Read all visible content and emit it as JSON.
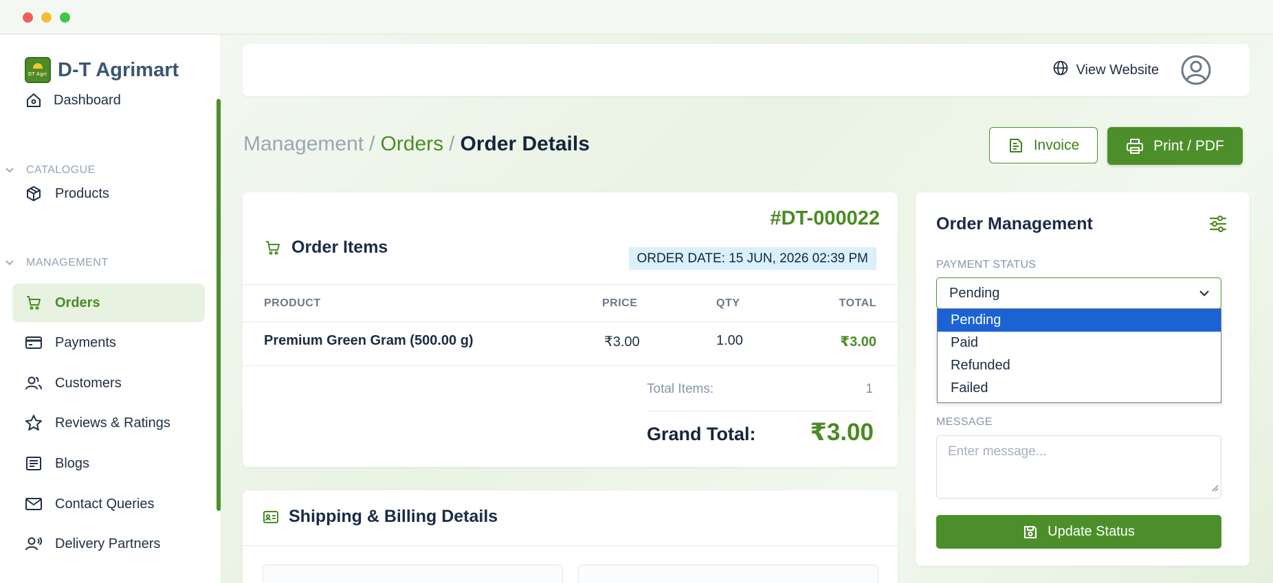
{
  "brand": {
    "name": "D-T Agrimart",
    "logo_text": "DT Agri"
  },
  "sidebar": {
    "dashboard": "Dashboard",
    "catalogue_heading": "CATALOGUE",
    "products": "Products",
    "management_heading": "MANAGEMENT",
    "orders": "Orders",
    "payments": "Payments",
    "customers": "Customers",
    "reviews": "Reviews & Ratings",
    "blogs": "Blogs",
    "contact": "Contact Queries",
    "delivery": "Delivery Partners"
  },
  "topbar": {
    "view_website": "View Website"
  },
  "breadcrumb": {
    "root": "Management",
    "sep": "/",
    "section": "Orders",
    "current": "Order Details"
  },
  "actions": {
    "invoice": "Invoice",
    "print": "Print / PDF"
  },
  "order": {
    "id": "#DT-000022",
    "date": "ORDER DATE: 15 JUN, 2026 02:39 PM",
    "items_title": "Order Items",
    "columns": [
      "PRODUCT",
      "PRICE",
      "QTY",
      "TOTAL"
    ],
    "rows": [
      {
        "product": "Premium Green Gram (500.00 g)",
        "price": "₹3.00",
        "qty": "1.00",
        "total": "₹3.00"
      }
    ],
    "total_items_label": "Total Items:",
    "total_items": "1",
    "grand_total_label": "Grand Total:",
    "grand_total": "₹3.00"
  },
  "shipping": {
    "title": "Shipping & Billing Details"
  },
  "management": {
    "title": "Order Management",
    "payment_status_label": "PAYMENT STATUS",
    "payment_status_value": "Pending",
    "options": [
      "Pending",
      "Paid",
      "Refunded",
      "Failed"
    ],
    "message_label": "MESSAGE",
    "message_placeholder": "Enter message...",
    "update_button": "Update Status"
  },
  "colors": {
    "accent": "#4c8f2a",
    "selected_option": "#1b63d4",
    "date_badge": "#daf0fb"
  }
}
